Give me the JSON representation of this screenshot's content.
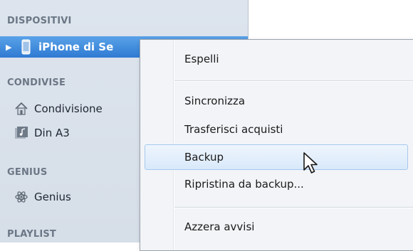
{
  "sidebar": {
    "sections": {
      "devices": "DISPOSITIVI",
      "shared": "CONDIVISE",
      "genius": "GENIUS",
      "playlist": "PLAYLIST"
    },
    "items": {
      "iphone": "iPhone di Se",
      "home_sharing": "Condivisione",
      "din_a3": "Din A3",
      "genius": "Genius"
    },
    "icons": {
      "disclosure": "disclosure-triangle-icon",
      "iphone": "iphone-icon",
      "home_sharing": "home-sharing-icon",
      "din_a3": "shared-library-icon",
      "genius": "genius-atom-icon"
    }
  },
  "context_menu": {
    "items": [
      "Espelli",
      "Sincronizza",
      "Trasferisci acquisti",
      "Backup",
      "Ripristina da backup...",
      "Azzera avvisi"
    ],
    "highlighted_item": "Backup"
  },
  "colors": {
    "selection": "#2f7ad3",
    "sidebar_bg": "#d6dee8",
    "menu_bg": "#f2f4f7"
  }
}
